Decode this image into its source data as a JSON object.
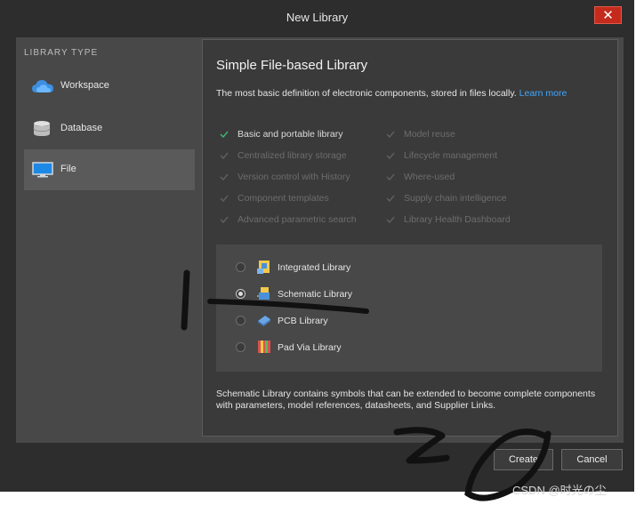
{
  "window": {
    "title": "New Library",
    "close_label": "✕"
  },
  "sidebar": {
    "title": "LIBRARY TYPE",
    "items": [
      {
        "label": "Workspace",
        "icon": "cloud-icon",
        "active": false
      },
      {
        "label": "Database",
        "icon": "database-icon",
        "active": false
      },
      {
        "label": "File",
        "icon": "monitor-icon",
        "active": true
      }
    ]
  },
  "panel": {
    "title": "Simple File-based Library",
    "description": "The most basic definition of electronic components, stored in files locally.",
    "learn_more": "Learn more",
    "features_left": [
      {
        "label": "Basic and portable library",
        "enabled": true
      },
      {
        "label": "Centralized library storage",
        "enabled": false
      },
      {
        "label": "Version control with History",
        "enabled": false
      },
      {
        "label": "Component templates",
        "enabled": false
      },
      {
        "label": "Advanced parametric search",
        "enabled": false
      }
    ],
    "features_right": [
      {
        "label": "Model reuse",
        "enabled": false
      },
      {
        "label": "Lifecycle management",
        "enabled": false
      },
      {
        "label": "Where-used",
        "enabled": false
      },
      {
        "label": "Supply chain intelligence",
        "enabled": false
      },
      {
        "label": "Library Health Dashboard",
        "enabled": false
      }
    ],
    "library_types": [
      {
        "label": "Integrated Library",
        "selected": false
      },
      {
        "label": "Schematic Library",
        "selected": true
      },
      {
        "label": "PCB Library",
        "selected": false
      },
      {
        "label": "Pad Via Library",
        "selected": false
      }
    ],
    "footer_description": "Schematic Library contains symbols that can be extended to become complete components with parameters, model references, datasheets, and Supplier Links."
  },
  "buttons": {
    "create": "Create",
    "cancel": "Cancel"
  },
  "watermark": "CSDN @时光の尘",
  "colors": {
    "accent_link": "#3fa7ff",
    "check_on": "#3cb371",
    "close_red": "#c42b1c"
  }
}
